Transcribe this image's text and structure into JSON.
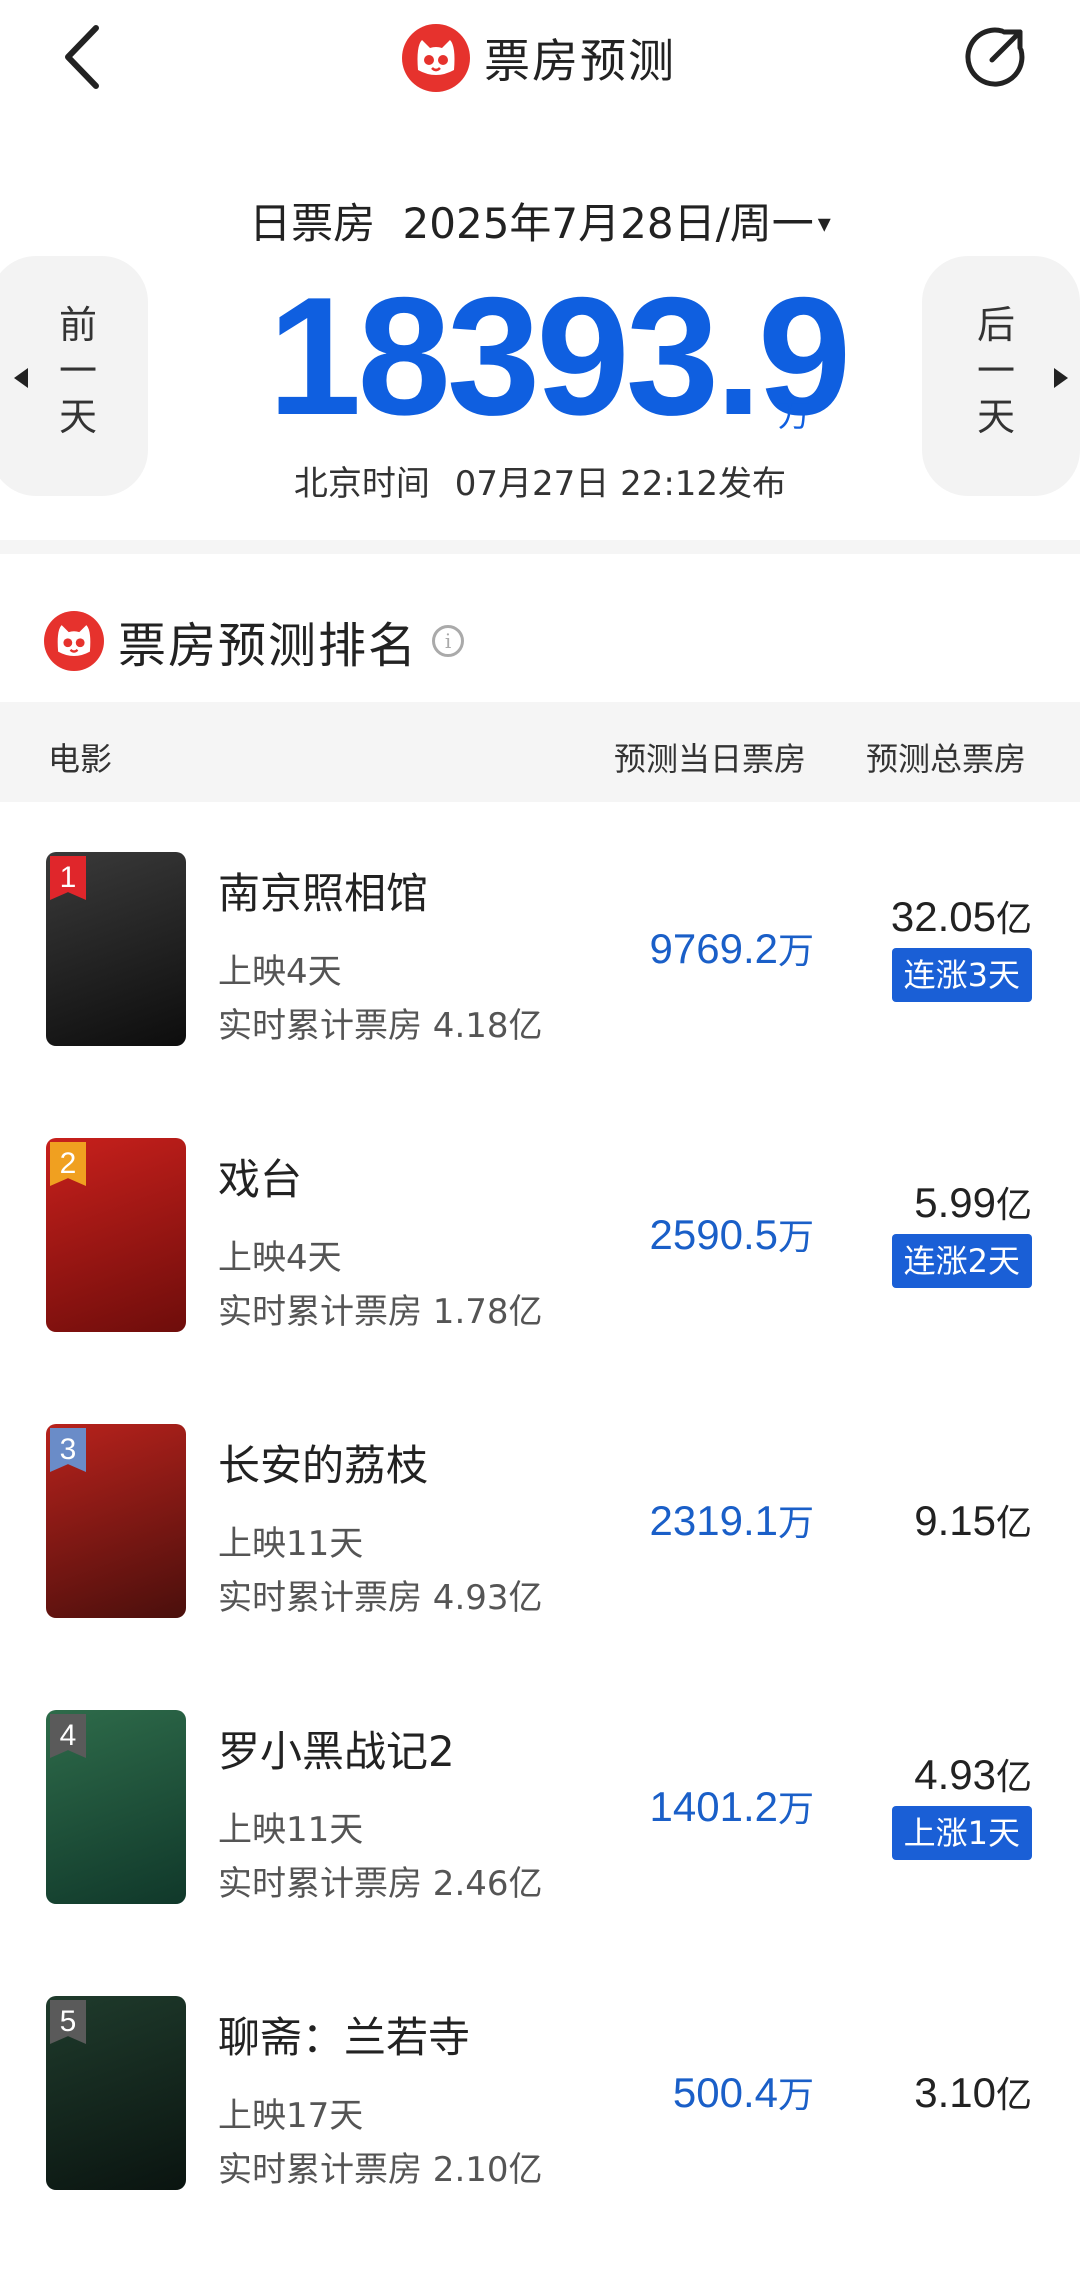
{
  "header": {
    "title": "票房预测",
    "back_icon": "chevron-left-icon",
    "share_icon": "share-icon"
  },
  "summary": {
    "date_label": "日票房",
    "date": "2025年7月28日/周一",
    "dropdown_icon": "▾",
    "box_office": "18393.9",
    "unit": "万",
    "release_prefix": "北京时间",
    "release_time": "07月27日 22:12发布",
    "prev_label": "前一天",
    "next_label": "后一天"
  },
  "ranking": {
    "title": "票房预测排名",
    "info_icon": "i",
    "columns": {
      "movie": "电影",
      "daily": "预测当日票房",
      "total": "预测总票房"
    },
    "rows": [
      {
        "rank": "1",
        "name": "南京照相馆",
        "days": "上映4天",
        "cumulative": "实时累计票房 4.18亿",
        "daily": "9769.2",
        "daily_unit": "万",
        "total": "32.05",
        "total_unit": "亿",
        "streak": "连涨3天",
        "badge_color": "#e0262b",
        "poster_colors": [
          "#3a3a3a",
          "#0d0d0d"
        ]
      },
      {
        "rank": "2",
        "name": "戏台",
        "days": "上映4天",
        "cumulative": "实时累计票房 1.78亿",
        "daily": "2590.5",
        "daily_unit": "万",
        "total": "5.99",
        "total_unit": "亿",
        "streak": "连涨2天",
        "badge_color": "#f0a020",
        "poster_colors": [
          "#c8201c",
          "#6e0d0b"
        ]
      },
      {
        "rank": "3",
        "name": "长安的荔枝",
        "days": "上映11天",
        "cumulative": "实时累计票房 4.93亿",
        "daily": "2319.1",
        "daily_unit": "万",
        "total": "9.15",
        "total_unit": "亿",
        "streak": "",
        "badge_color": "#6a8cc8",
        "poster_colors": [
          "#b8221c",
          "#4a0f0c"
        ]
      },
      {
        "rank": "4",
        "name": "罗小黑战记2",
        "days": "上映11天",
        "cumulative": "实时累计票房 2.46亿",
        "daily": "1401.2",
        "daily_unit": "万",
        "total": "4.93",
        "total_unit": "亿",
        "streak": "上涨1天",
        "badge_color": "#5a5a5a",
        "poster_colors": [
          "#2e6b4a",
          "#10382a"
        ]
      },
      {
        "rank": "5",
        "name": "聊斋：兰若寺",
        "days": "上映17天",
        "cumulative": "实时累计票房 2.10亿",
        "daily": "500.4",
        "daily_unit": "万",
        "total": "3.10",
        "total_unit": "亿",
        "streak": "",
        "badge_color": "#5a5a5a",
        "poster_colors": [
          "#1f3b2c",
          "#0a1410"
        ]
      }
    ]
  }
}
